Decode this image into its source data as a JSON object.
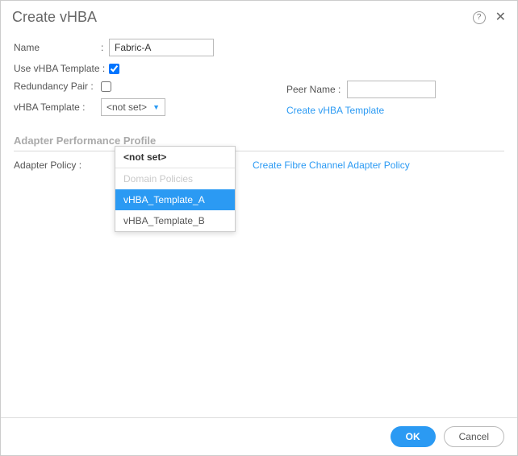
{
  "dialog": {
    "title": "Create vHBA"
  },
  "fields": {
    "name_label": "Name",
    "name_value": "Fabric-A",
    "use_template_label": "Use vHBA Template :",
    "use_template_checked": true,
    "redundancy_label": "Redundancy Pair :",
    "redundancy_checked": false,
    "peer_label": "Peer Name :",
    "peer_value": "",
    "template_label": "vHBA Template :",
    "template_selected": "<not set>",
    "create_template_link": "Create vHBA Template",
    "adapter_section": "Adapter Performance Profile",
    "adapter_policy_label": "Adapter Policy :",
    "create_adapter_link": "Create Fibre Channel Adapter Policy"
  },
  "dropdown": {
    "items": [
      {
        "label": "<not set>",
        "type": "notset"
      },
      {
        "label": "Domain Policies",
        "type": "group"
      },
      {
        "label": "vHBA_Template_A",
        "type": "highlight"
      },
      {
        "label": "vHBA_Template_B",
        "type": "item"
      }
    ]
  },
  "buttons": {
    "ok": "OK",
    "cancel": "Cancel"
  }
}
